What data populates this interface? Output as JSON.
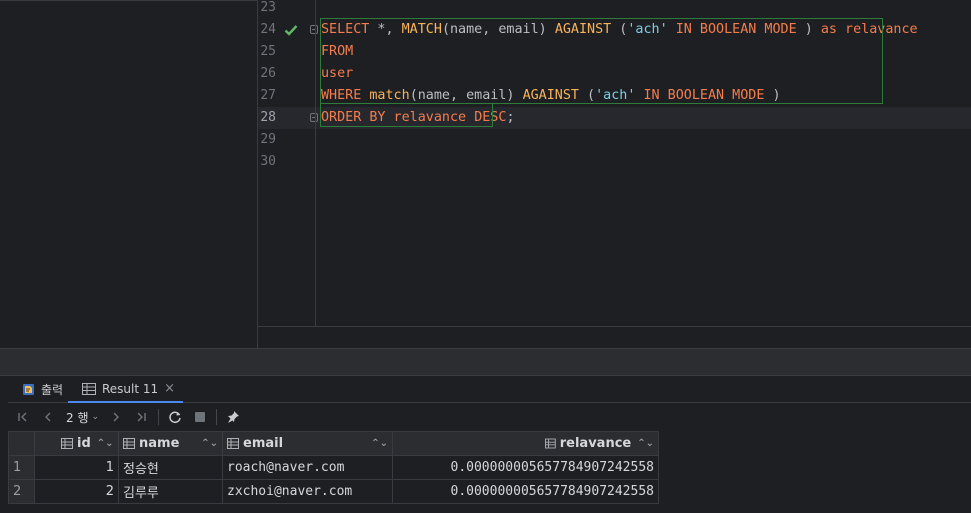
{
  "editor": {
    "lines": [
      {
        "no": "23",
        "tokens": []
      },
      {
        "no": "24",
        "status": "check-icon",
        "fold": true,
        "tokens": [
          {
            "t": "SELECT",
            "c": "kw"
          },
          {
            "t": " *, ",
            "c": "plain"
          },
          {
            "t": "MATCH",
            "c": "fn"
          },
          {
            "t": "(name, email) ",
            "c": "plain"
          },
          {
            "t": "AGAINST",
            "c": "fn"
          },
          {
            "t": " (",
            "c": "plain"
          },
          {
            "t": "'ach'",
            "c": "str"
          },
          {
            "t": " ",
            "c": "plain"
          },
          {
            "t": "IN BOOLEAN MODE",
            "c": "kw"
          },
          {
            "t": " ) ",
            "c": "plain"
          },
          {
            "t": "as relavance",
            "c": "kw"
          }
        ]
      },
      {
        "no": "25",
        "tokens": [
          {
            "t": "FROM",
            "c": "kw"
          }
        ]
      },
      {
        "no": "26",
        "tokens": [
          {
            "t": "user",
            "c": "kw"
          }
        ]
      },
      {
        "no": "27",
        "tokens": [
          {
            "t": "WHERE",
            "c": "kw"
          },
          {
            "t": " ",
            "c": "plain"
          },
          {
            "t": "match",
            "c": "fn"
          },
          {
            "t": "(name, email) ",
            "c": "plain"
          },
          {
            "t": "AGAINST",
            "c": "fn"
          },
          {
            "t": " (",
            "c": "plain"
          },
          {
            "t": "'ach'",
            "c": "str"
          },
          {
            "t": " ",
            "c": "plain"
          },
          {
            "t": "IN BOOLEAN MODE",
            "c": "kw"
          },
          {
            "t": " )",
            "c": "plain"
          }
        ]
      },
      {
        "no": "28",
        "current": true,
        "fold": true,
        "tokens": [
          {
            "t": "ORDER BY",
            "c": "kw"
          },
          {
            "t": " relavance ",
            "c": "kw"
          },
          {
            "t": "DESC",
            "c": "kw"
          },
          {
            "t": ";",
            "c": "plain"
          }
        ]
      },
      {
        "no": "29",
        "tokens": []
      },
      {
        "no": "30",
        "tokens": []
      }
    ]
  },
  "results": {
    "tabs": {
      "output": {
        "label": "출력",
        "icon": "output-icon"
      },
      "result": {
        "label": "Result 11",
        "icon": "table-icon",
        "close": "×"
      }
    },
    "toolbar": {
      "page_label": "2 행",
      "buttons": [
        "first-page-icon",
        "prev-page-icon",
        "next-page-icon",
        "last-page-icon",
        "refresh-icon",
        "stop-icon",
        "pin-icon"
      ]
    },
    "columns": [
      {
        "key": "id",
        "label": "id"
      },
      {
        "key": "name",
        "label": "name"
      },
      {
        "key": "email",
        "label": "email"
      },
      {
        "key": "relavance",
        "label": "relavance"
      }
    ],
    "rows": [
      {
        "rownum": "1",
        "id": "1",
        "name": "정승현",
        "email": "roach@naver.com",
        "relavance": "0.0000000056577849072425​58"
      },
      {
        "rownum": "2",
        "id": "2",
        "name": "김루루",
        "email": "zxchoi@naver.com",
        "relavance": "0.000000005657784907242558"
      }
    ]
  }
}
